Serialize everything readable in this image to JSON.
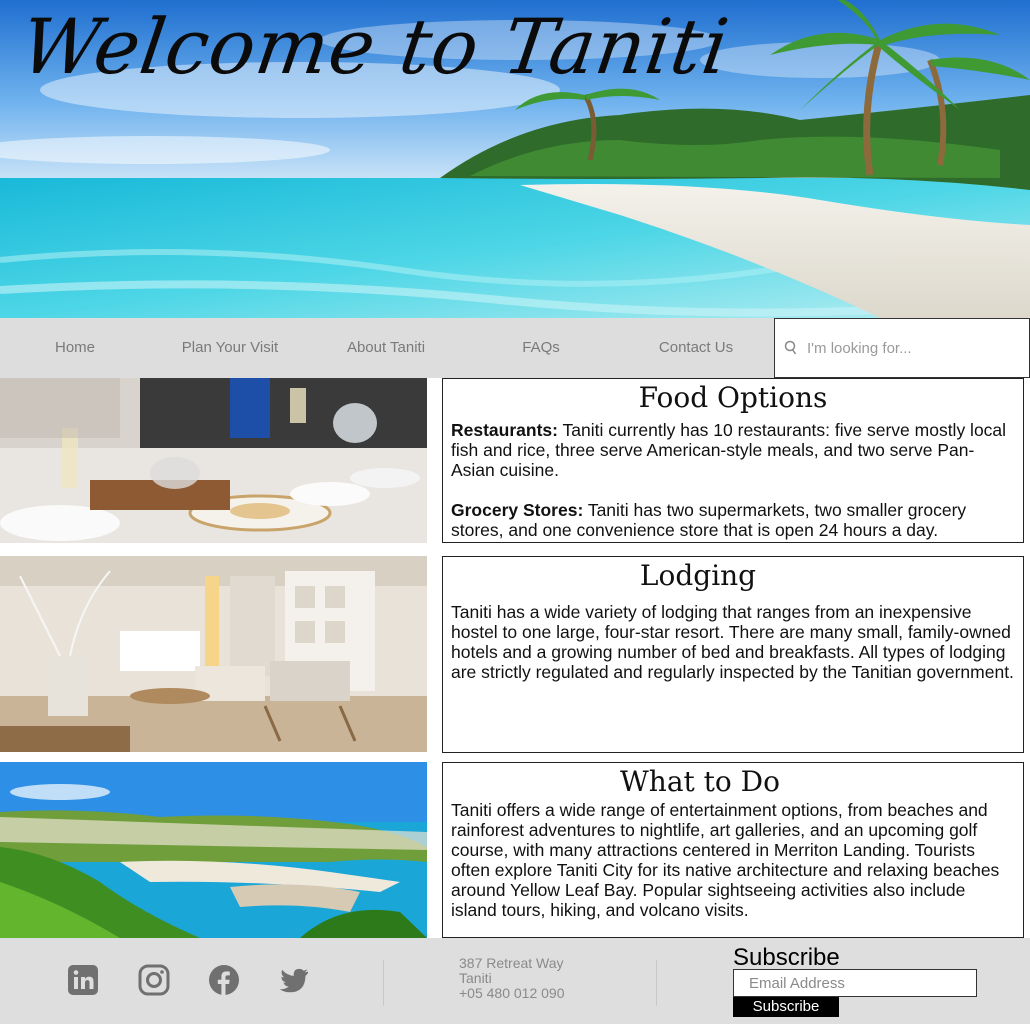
{
  "hero": {
    "title": "Welcome to Taniti"
  },
  "nav": {
    "items": [
      "Home",
      "Plan Your Visit",
      "About Taniti",
      "FAQs",
      "Contact Us"
    ],
    "search_placeholder": "I'm looking for..."
  },
  "sections": {
    "food": {
      "title": "Food Options",
      "restaurants_label": "Restaurants:",
      "restaurants_text": " Taniti currently has 10 restaurants: five serve mostly local fish and rice, three serve American-style meals, and two serve Pan-Asian cuisine.",
      "grocery_label": "Grocery Stores:",
      "grocery_text": " Taniti has two supermarkets, two smaller grocery stores, and one convenience store that is open 24 hours a day."
    },
    "lodging": {
      "title": "Lodging",
      "text": "Taniti has a wide variety of lodging that ranges from an inexpensive hostel to one large, four-star resort. There are many small, family-owned hotels and a growing number of bed and breakfasts. All types of lodging are strictly regulated and regularly inspected by the Tanitian government."
    },
    "todo": {
      "title": "What to Do",
      "text": "Taniti offers a wide range of entertainment options, from beaches and rainforest adventures to nightlife, art galleries, and an upcoming golf course, with many attractions centered in Merriton Landing. Tourists often explore Taniti City for its native architecture and relaxing beaches around Yellow Leaf Bay. Popular sightseeing activities also include island tours, hiking, and volcano visits."
    }
  },
  "footer": {
    "social_icons": [
      "linkedin-icon",
      "instagram-icon",
      "facebook-icon",
      "twitter-icon"
    ],
    "address_line1": "387 Retreat Way",
    "address_line2": "Taniti",
    "phone": "+05 480 012 090",
    "subscribe_title": "Subscribe",
    "email_placeholder": "Email Address",
    "subscribe_button": "Subscribe"
  }
}
